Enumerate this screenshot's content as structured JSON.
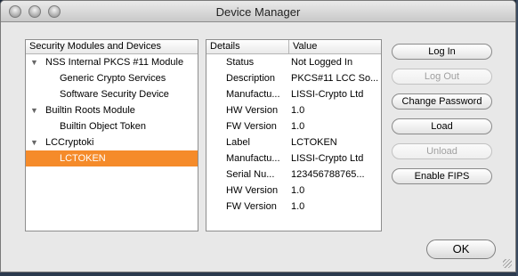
{
  "window": {
    "title": "Device Manager"
  },
  "tree": {
    "header": "Security Modules and Devices",
    "items": [
      {
        "label": "NSS Internal PKCS #11 Module",
        "level": 0,
        "expanded": true
      },
      {
        "label": "Generic Crypto Services",
        "level": 1
      },
      {
        "label": "Software Security Device",
        "level": 1
      },
      {
        "label": "Builtin Roots Module",
        "level": 0,
        "expanded": true
      },
      {
        "label": "Builtin Object Token",
        "level": 1
      },
      {
        "label": "LCCryptoki",
        "level": 0,
        "expanded": true
      },
      {
        "label": "LCTOKEN",
        "level": 1,
        "selected": true
      }
    ]
  },
  "details": {
    "header_details": "Details",
    "header_value": "Value",
    "rows": [
      {
        "detail": "Status",
        "value": "Not Logged In"
      },
      {
        "detail": "Description",
        "value": "PKCS#11 LCC So..."
      },
      {
        "detail": "Manufactu...",
        "value": "LISSI-Crypto Ltd"
      },
      {
        "detail": "HW Version",
        "value": "1.0"
      },
      {
        "detail": "FW Version",
        "value": "1.0"
      },
      {
        "detail": "Label",
        "value": "LCTOKEN"
      },
      {
        "detail": "Manufactu...",
        "value": "LISSI-Crypto Ltd"
      },
      {
        "detail": "Serial Nu...",
        "value": "123456788765..."
      },
      {
        "detail": "HW Version",
        "value": "1.0"
      },
      {
        "detail": "FW Version",
        "value": "1.0"
      }
    ]
  },
  "buttons": {
    "log_in": "Log In",
    "log_out": "Log Out",
    "change_password": "Change Password",
    "load": "Load",
    "unload": "Unload",
    "enable_fips": "Enable FIPS",
    "ok": "OK"
  },
  "colors": {
    "selection": "#f58b2a"
  }
}
